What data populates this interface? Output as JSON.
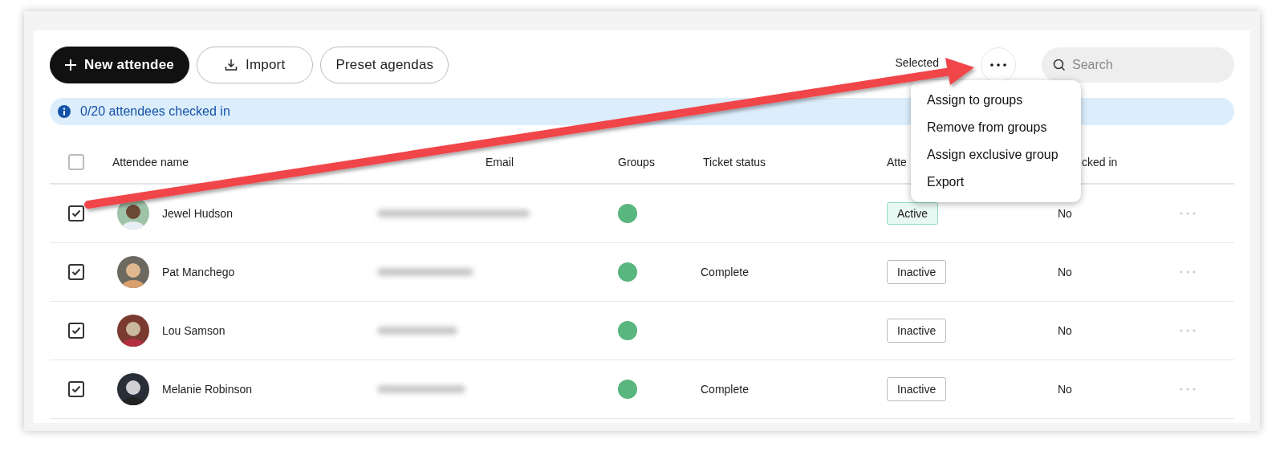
{
  "toolbar": {
    "buttons": [
      {
        "label": "New attendee",
        "kind": "primary"
      },
      {
        "label": "Import",
        "kind": "import"
      },
      {
        "label": "Preset agendas",
        "kind": "plain"
      }
    ],
    "selected_label": "Selected",
    "search": {
      "placeholder": "Search"
    }
  },
  "banner": {
    "text": "0/20 attendees checked in"
  },
  "table": {
    "select_all": {
      "checked": false
    },
    "columns": [
      "Attendee name",
      "Email",
      "Groups",
      "Ticket status",
      "Atte",
      "cked in"
    ],
    "rows": [
      {
        "checked": true,
        "name": "Jewel Hudson",
        "attendance": {
          "label": "Active",
          "active": true
        },
        "checked_in": "No"
      },
      {
        "checked": true,
        "name": "Pat Manchego",
        "ticket_status": "Complete",
        "attendance": {
          "label": "Inactive",
          "active": false
        },
        "checked_in": "No"
      },
      {
        "checked": true,
        "name": "Lou Samson",
        "attendance": {
          "label": "Inactive",
          "active": false
        },
        "checked_in": "No"
      },
      {
        "checked": true,
        "name": "Melanie Robinson",
        "ticket_status": "Complete",
        "attendance": {
          "label": "Inactive",
          "active": false
        },
        "checked_in": "No"
      }
    ]
  },
  "menu": {
    "items": [
      "Assign to groups",
      "Remove from groups",
      "Assign exclusive group",
      "Export"
    ]
  }
}
